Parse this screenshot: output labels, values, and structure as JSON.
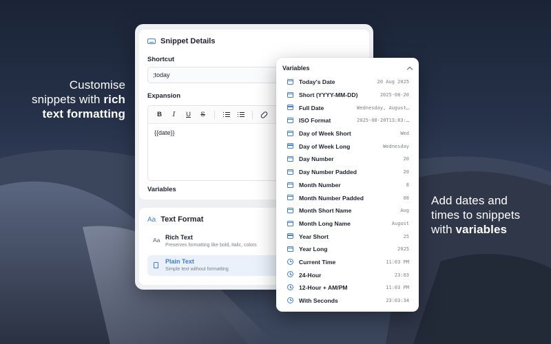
{
  "promo": {
    "left_line1": "Customise",
    "left_line2": "snippets with",
    "left_bold1": "rich",
    "left_bold2": "text formatting",
    "right_line1": "Add dates and",
    "right_line2": "times to snippets",
    "right_line3": "with",
    "right_bold": "variables"
  },
  "snippet": {
    "section_title": "Snippet Details",
    "shortcut_label": "Shortcut",
    "shortcut_value": ";today",
    "expansion_label": "Expansion",
    "toolbar": {
      "bold": "B",
      "italic": "I",
      "underline": "U",
      "strike": "S"
    },
    "expansion_value": "{{date}}",
    "variables_label": "Variables"
  },
  "text_format": {
    "icon": "Aa",
    "title": "Text Format",
    "options": [
      {
        "icon": "Aa",
        "title": "Rich Text",
        "desc": "Preserves formatting like bold, italic, colors",
        "selected": false
      },
      {
        "icon": "doc-icon",
        "title": "Plain Text",
        "desc": "Simple text without formatting",
        "selected": true
      }
    ]
  },
  "variables_menu": {
    "title": "Variables",
    "items": [
      {
        "icon": "calendar",
        "name": "Today's Date",
        "value": "20 Aug 2025"
      },
      {
        "icon": "calendar",
        "name": "Short (YYYY-MM-DD)",
        "value": "2025-08-20"
      },
      {
        "icon": "calendar",
        "name": "Full Date",
        "value": "Wednesday, August…"
      },
      {
        "icon": "calendar",
        "name": "ISO Format",
        "value": "2025-08-20T13:03:…"
      },
      {
        "icon": "calendar",
        "name": "Day of Week Short",
        "value": "Wed"
      },
      {
        "icon": "calendar",
        "name": "Day of Week Long",
        "value": "Wednesday"
      },
      {
        "icon": "calendar",
        "name": "Day Number",
        "value": "20"
      },
      {
        "icon": "calendar",
        "name": "Day Number Padded",
        "value": "20"
      },
      {
        "icon": "calendar",
        "name": "Month Number",
        "value": "8"
      },
      {
        "icon": "calendar",
        "name": "Month Number Padded",
        "value": "08"
      },
      {
        "icon": "calendar",
        "name": "Month Short Name",
        "value": "Aug"
      },
      {
        "icon": "calendar",
        "name": "Month Long Name",
        "value": "August"
      },
      {
        "icon": "calendar",
        "name": "Year Short",
        "value": "25"
      },
      {
        "icon": "calendar",
        "name": "Year Long",
        "value": "2025"
      },
      {
        "icon": "clock",
        "name": "Current Time",
        "value": "11:03 PM"
      },
      {
        "icon": "clock",
        "name": "24-Hour",
        "value": "23:03"
      },
      {
        "icon": "clock",
        "name": "12-Hour + AM/PM",
        "value": "11:03 PM"
      },
      {
        "icon": "clock",
        "name": "With Seconds",
        "value": "23:03:34"
      }
    ]
  },
  "colors": {
    "accent": "#3d7fd6",
    "selected_bg": "#eaf1fb"
  }
}
